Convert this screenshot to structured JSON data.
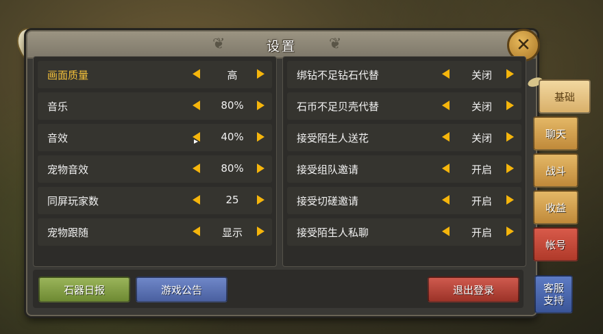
{
  "window": {
    "title": "设置"
  },
  "left_settings": [
    {
      "label": "画面质量",
      "value": "高",
      "highlight": true
    },
    {
      "label": "音乐",
      "value": "80%"
    },
    {
      "label": "音效",
      "value": "40%"
    },
    {
      "label": "宠物音效",
      "value": "80%"
    },
    {
      "label": "同屏玩家数",
      "value": "25"
    },
    {
      "label": "宠物跟随",
      "value": "显示"
    }
  ],
  "right_settings": [
    {
      "label": "绑钻不足钻石代替",
      "value": "关闭"
    },
    {
      "label": "石币不足贝壳代替",
      "value": "关闭"
    },
    {
      "label": "接受陌生人送花",
      "value": "关闭"
    },
    {
      "label": "接受组队邀请",
      "value": "开启"
    },
    {
      "label": "接受切磋邀请",
      "value": "开启"
    },
    {
      "label": "接受陌生人私聊",
      "value": "开启"
    }
  ],
  "bottom_buttons": {
    "daily_report": "石器日报",
    "announcement": "游戏公告",
    "logout": "退出登录"
  },
  "tabs": {
    "basic": "基础",
    "chat": "聊天",
    "battle": "战斗",
    "income": "收益",
    "account": "帐号",
    "support": [
      "客服",
      "支持"
    ]
  },
  "icons": {
    "close": "close-x-icon",
    "arrow_left": "arrow-left-icon",
    "arrow_right": "arrow-right-icon"
  },
  "colors": {
    "accent_arrow": "#f5b50c",
    "highlight_label": "#f6c23a",
    "panel_bg": "#3a3935"
  }
}
